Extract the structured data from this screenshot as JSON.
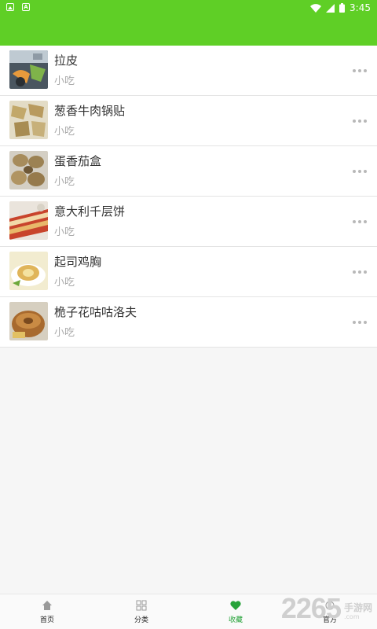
{
  "status_bar": {
    "time": "3:45",
    "icons": [
      "image-notification-icon",
      "a-notification-icon",
      "wifi-icon",
      "cell-signal-icon",
      "battery-icon"
    ]
  },
  "app_bar": {
    "color": "#5fcf26"
  },
  "favorites": [
    {
      "title": "拉皮",
      "category": "小吃"
    },
    {
      "title": "葱香牛肉锅贴",
      "category": "小吃"
    },
    {
      "title": "蛋香茄盒",
      "category": "小吃"
    },
    {
      "title": "意大利千层饼",
      "category": "小吃"
    },
    {
      "title": "起司鸡胸",
      "category": "小吃"
    },
    {
      "title": "桅子花咕咕洛夫",
      "category": "小吃"
    }
  ],
  "bottom_nav": {
    "items": [
      {
        "label": "首页",
        "icon": "home-icon",
        "active": false
      },
      {
        "label": "分类",
        "icon": "grid-icon",
        "active": false
      },
      {
        "label": "收藏",
        "icon": "heart-icon",
        "active": true
      },
      {
        "label": "官方",
        "icon": "official-icon",
        "active": false
      }
    ],
    "active_color": "#27a33a"
  },
  "watermark": {
    "number": "2265",
    "site_cn": "手游网",
    "site_url": ".com"
  }
}
